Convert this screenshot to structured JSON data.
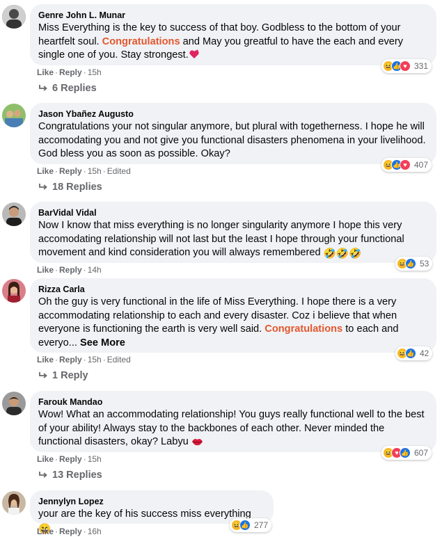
{
  "comments": [
    {
      "author": "Genre John L. Munar",
      "text_a": "Miss Everything is the key to success of that boy. Godbless to the bottom of your heartfelt soul. ",
      "highlight": "Congratulations",
      "text_b": " and May you greatful to have the each and every single one of you. Stay strongest.",
      "like": "Like",
      "reply": "Reply",
      "time": "15h",
      "edited": "",
      "reaction_count": "331",
      "replies": "6 Replies"
    },
    {
      "author": "Jason Ybañez Augusto",
      "text": "Congratulations your not singular anymore, but plural with togetherness. I hope he will accomodating you and not give you functional disasters phenomena in your livelihood. God bless you as soon as possible. Okay?",
      "like": "Like",
      "reply": "Reply",
      "time": "15h",
      "edited": "Edited",
      "reaction_count": "407",
      "replies": "18 Replies"
    },
    {
      "author": "BarVidal Vidal",
      "text": "Now I know that miss everything is no longer singularity anymore I hope this very accomodating relationship will not last but the least I hope through your functional movement and kind consideration you will always remembered",
      "like": "Like",
      "reply": "Reply",
      "time": "14h",
      "reaction_count": "53"
    },
    {
      "author": "Rizza Carla",
      "text_a": "Oh the guy is very functional in the life of Miss Everything. I hope there is a very accommodating relationship to each and every disaster. Coz i believe that when everyone is functioning the earth is very well said. ",
      "highlight": "Congratulations",
      "text_b": " to each and everyo...",
      "see_more": "See More",
      "like": "Like",
      "reply": "Reply",
      "time": "15h",
      "edited": "Edited",
      "reaction_count": "42",
      "replies": "1 Reply"
    },
    {
      "author": "Farouk Mandao",
      "text": "Wow! What an accommodating relationship! You guys really functional well to the best of your ability! Always stay to the backbones of each other. Never minded the functional disasters, okay? Labyu",
      "like": "Like",
      "reply": "Reply",
      "time": "15h",
      "reaction_count": "607",
      "replies": "13 Replies"
    },
    {
      "author": "Jennylyn Lopez",
      "text": "your are the key of his success miss everything",
      "like": "Like",
      "reply": "Reply",
      "time": "16h",
      "reaction_count": "277"
    }
  ],
  "colors": {
    "bubble": "#f0f2f5",
    "highlight": "#e4572e",
    "meta": "#65676b",
    "like_blue": "#1b74e4",
    "haha_yellow": "#f7b928",
    "love_red": "#f33e58"
  },
  "icons": [
    "reply-arrow-icon",
    "haha-reaction-icon",
    "like-reaction-icon",
    "love-reaction-icon"
  ]
}
